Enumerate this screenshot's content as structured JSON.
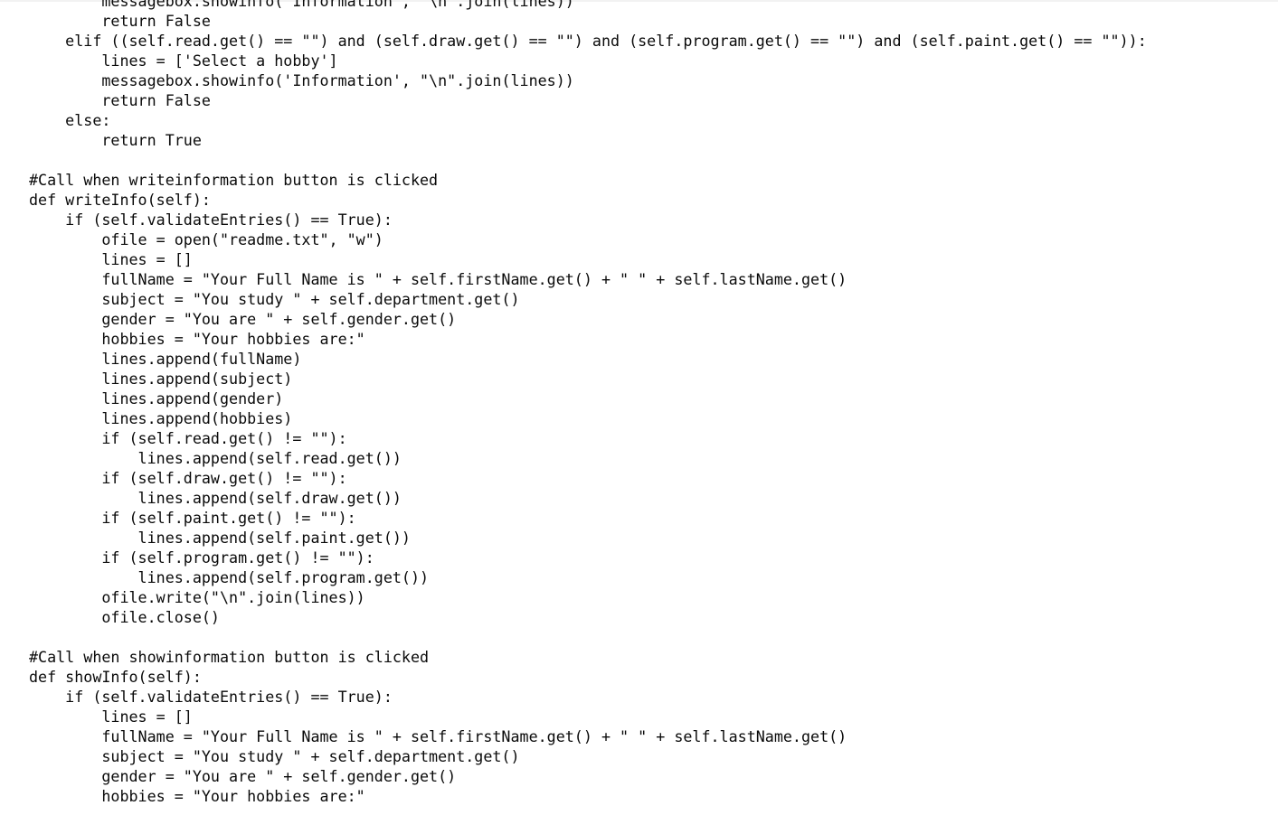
{
  "document": {
    "kind": "source-code-listing",
    "language": "Python",
    "background_color": "#ffffff",
    "text_color": "#0a0a0a",
    "top_edge_color": "#f2f2f2"
  },
  "code": {
    "lines": [
      "        messagebox.showinfo('Information', \"\\n\".join(lines))",
      "        return False",
      "    elif ((self.read.get() == \"\") and (self.draw.get() == \"\") and (self.program.get() == \"\") and (self.paint.get() == \"\")):",
      "        lines = ['Select a hobby']",
      "        messagebox.showinfo('Information', \"\\n\".join(lines))",
      "        return False",
      "    else:",
      "        return True",
      "",
      "#Call when writeinformation button is clicked",
      "def writeInfo(self):",
      "    if (self.validateEntries() == True):",
      "        ofile = open(\"readme.txt\", \"w\")",
      "        lines = []",
      "        fullName = \"Your Full Name is \" + self.firstName.get() + \" \" + self.lastName.get()",
      "        subject = \"You study \" + self.department.get()",
      "        gender = \"You are \" + self.gender.get()",
      "        hobbies = \"Your hobbies are:\"",
      "        lines.append(fullName)",
      "        lines.append(subject)",
      "        lines.append(gender)",
      "        lines.append(hobbies)",
      "        if (self.read.get() != \"\"):",
      "            lines.append(self.read.get())",
      "        if (self.draw.get() != \"\"):",
      "            lines.append(self.draw.get())",
      "        if (self.paint.get() != \"\"):",
      "            lines.append(self.paint.get())",
      "        if (self.program.get() != \"\"):",
      "            lines.append(self.program.get())",
      "        ofile.write(\"\\n\".join(lines))",
      "        ofile.close()",
      "",
      "#Call when showinformation button is clicked",
      "def showInfo(self):",
      "    if (self.validateEntries() == True):",
      "        lines = []",
      "        fullName = \"Your Full Name is \" + self.firstName.get() + \" \" + self.lastName.get()",
      "        subject = \"You study \" + self.department.get()",
      "        gender = \"You are \" + self.gender.get()",
      "        hobbies = \"Your hobbies are:\""
    ]
  }
}
